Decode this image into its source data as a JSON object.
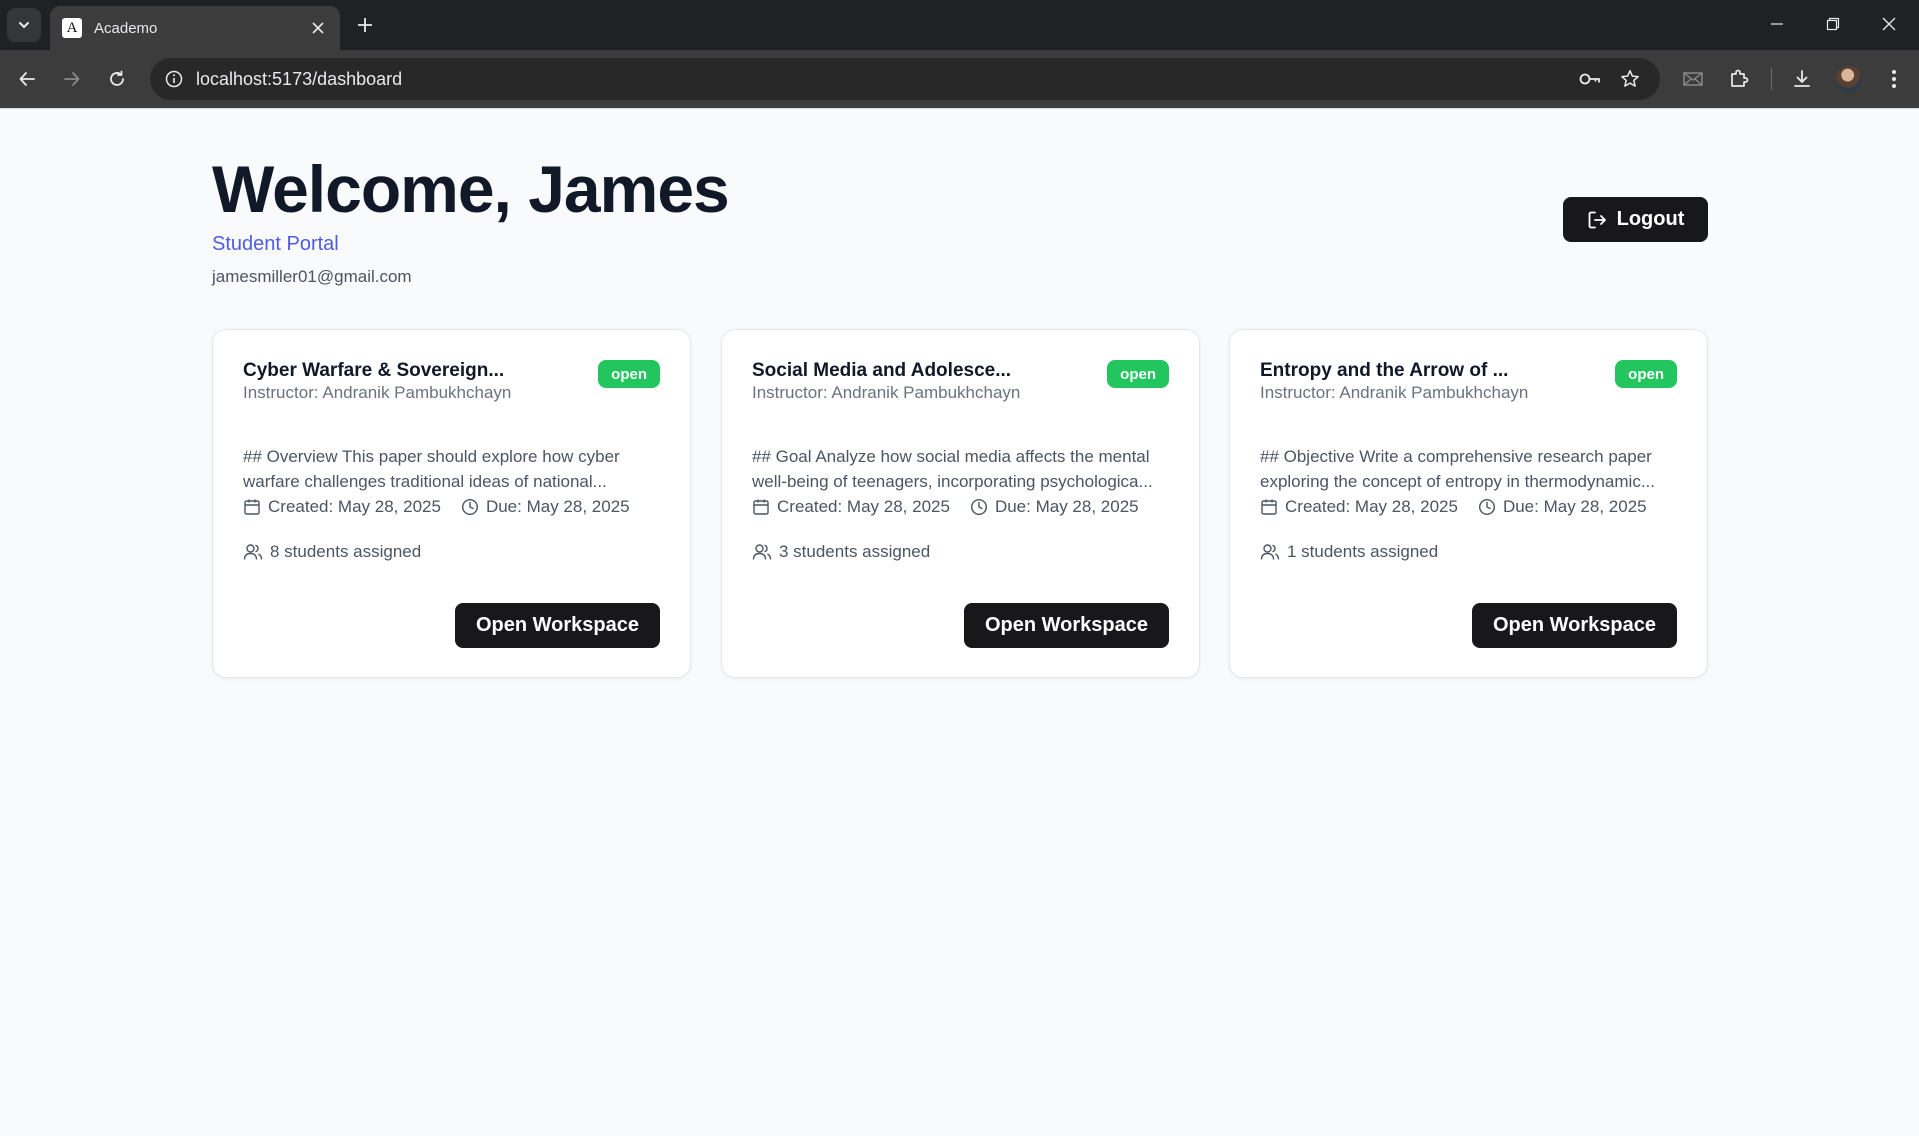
{
  "browser": {
    "tab_title": "Academo",
    "favicon_letter": "A",
    "url": "localhost:5173/dashboard"
  },
  "header": {
    "welcome": "Welcome, James",
    "portal": "Student Portal",
    "email": "jamesmiller01@gmail.com",
    "logout_label": "Logout"
  },
  "cards": [
    {
      "title": "Cyber Warfare & Sovereign...",
      "status": "open",
      "instructor": "Instructor: Andranik Pambukhchayn",
      "description": "## Overview This paper should explore how cyber warfare challenges traditional ideas of national...",
      "created": "Created: May 28, 2025",
      "due": "Due: May 28, 2025",
      "assigned": "8 students assigned",
      "button": "Open Workspace"
    },
    {
      "title": "Social Media and Adolesce...",
      "status": "open",
      "instructor": "Instructor: Andranik Pambukhchayn",
      "description": "## Goal Analyze how social media affects the mental well-being of teenagers, incorporating psychologica...",
      "created": "Created: May 28, 2025",
      "due": "Due: May 28, 2025",
      "assigned": "3 students assigned",
      "button": "Open Workspace"
    },
    {
      "title": "Entropy and the Arrow of ...",
      "status": "open",
      "instructor": "Instructor: Andranik Pambukhchayn",
      "description": "## Objective Write a comprehensive research paper exploring the concept of entropy in thermodynamic...",
      "created": "Created: May 28, 2025",
      "due": "Due: May 28, 2025",
      "assigned": "1 students assigned",
      "button": "Open Workspace"
    }
  ],
  "colors": {
    "accent": "#4f5be8",
    "status_open": "#22c55e",
    "button_dark": "#18181b"
  }
}
